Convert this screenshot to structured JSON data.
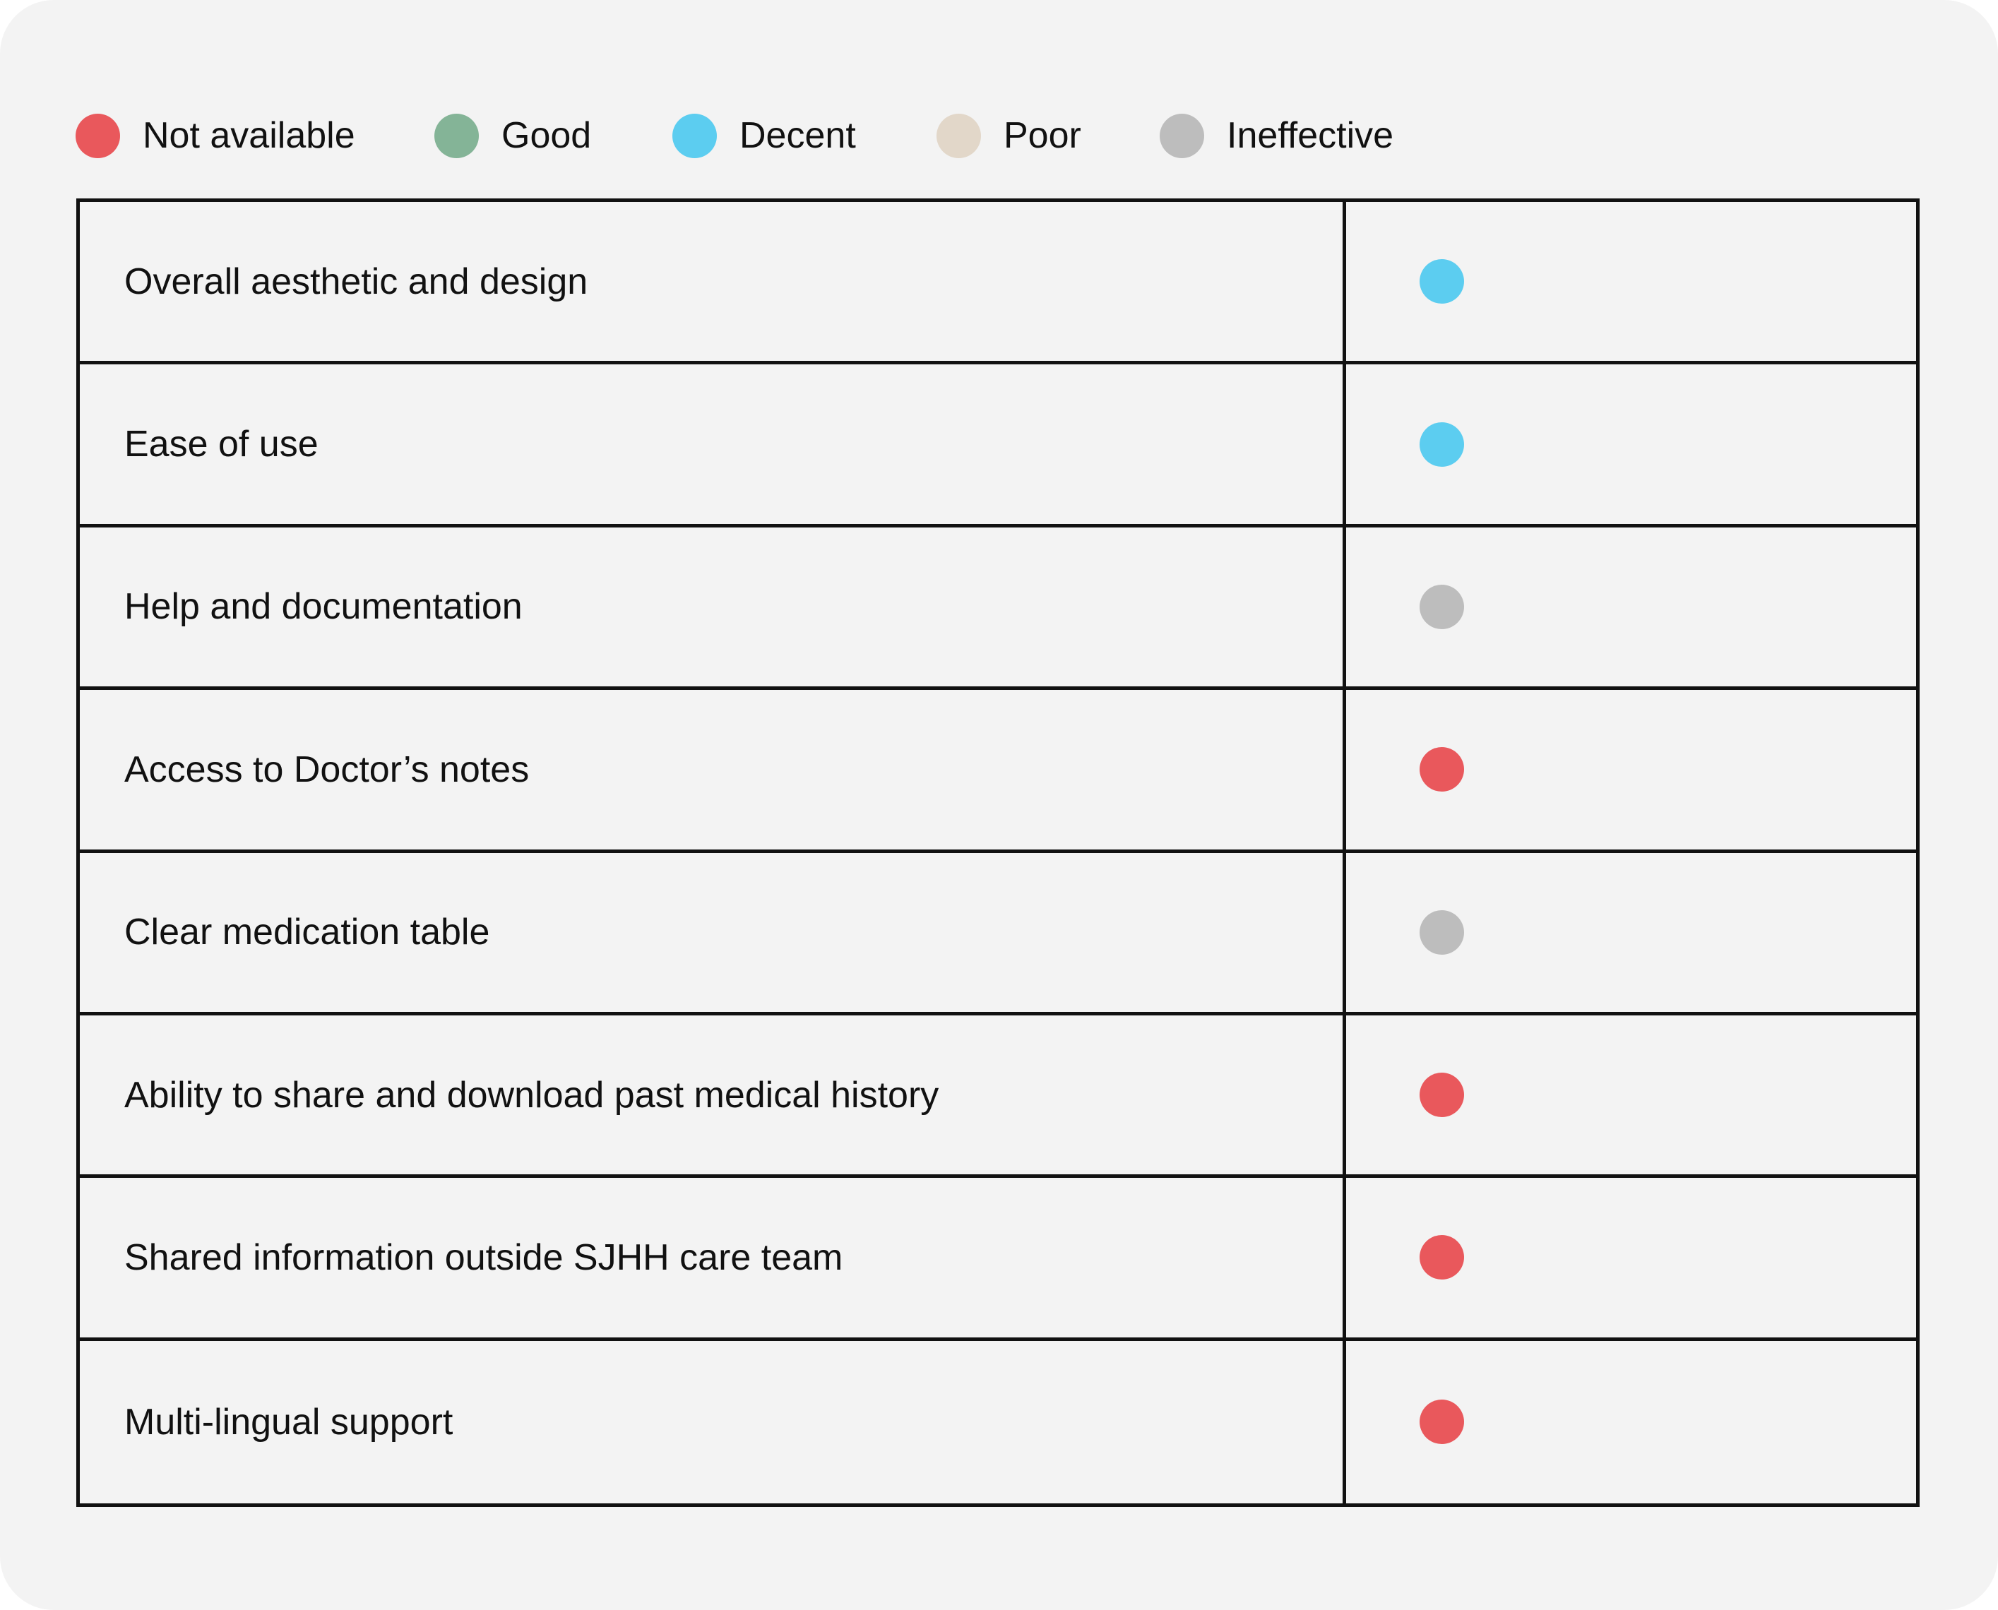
{
  "legend": [
    {
      "key": "not_available",
      "label": "Not available",
      "color": "#e9585c"
    },
    {
      "key": "good",
      "label": "Good",
      "color": "#84b497"
    },
    {
      "key": "decent",
      "label": "Decent",
      "color": "#5ccdf0"
    },
    {
      "key": "poor",
      "label": "Poor",
      "color": "#e2d7c9"
    },
    {
      "key": "ineffective",
      "label": "Ineffective",
      "color": "#bdbdbd"
    }
  ],
  "rows": [
    {
      "label": "Overall aesthetic and design",
      "rating": "decent",
      "color": "#5ccdf0"
    },
    {
      "label": "Ease of use",
      "rating": "decent",
      "color": "#5ccdf0"
    },
    {
      "label": "Help and documentation",
      "rating": "ineffective",
      "color": "#bdbdbd"
    },
    {
      "label": "Access to Doctor’s notes",
      "rating": "not_available",
      "color": "#e9585c"
    },
    {
      "label": "Clear medication table",
      "rating": "ineffective",
      "color": "#bdbdbd"
    },
    {
      "label": "Ability to share and download past medical history",
      "rating": "not_available",
      "color": "#e9585c"
    },
    {
      "label": "Shared information outside SJHH care team",
      "rating": "not_available",
      "color": "#e9585c"
    },
    {
      "label": "Multi-lingual support",
      "rating": "not_available",
      "color": "#e9585c"
    }
  ]
}
